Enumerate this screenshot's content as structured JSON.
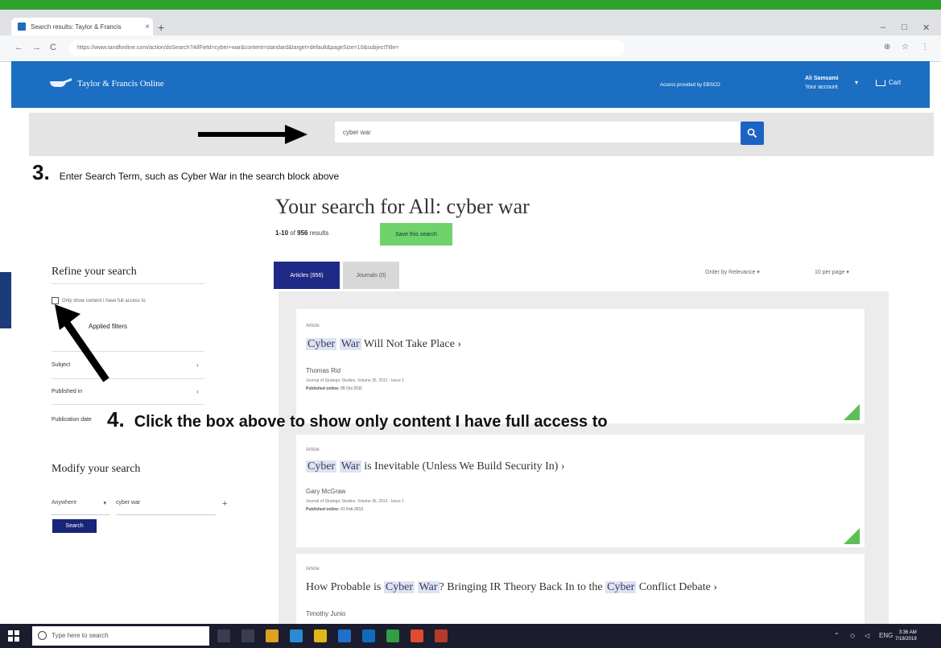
{
  "browser": {
    "strip_note": "",
    "tab_title": "Search results: Taylor & Francis",
    "tab_close": "×",
    "new_tab": "+",
    "url": "https://www.tandfonline.com/action/doSearch?AllField=cyber+war&content=standard&target=default&pageSize=10&subjectTitle=",
    "nav": {
      "back": "←",
      "forward": "→",
      "reload": "C"
    },
    "window_controls": [
      "–",
      "□",
      "✕"
    ]
  },
  "header": {
    "logo_text": "Taylor & Francis Online",
    "access_text": "Access provided by EBSCO",
    "account_name": "Ali Samsami",
    "account_sub": "Your account",
    "cart_label": "Cart"
  },
  "search": {
    "value": "cyber war"
  },
  "annotations": {
    "step3_num": "3.",
    "step3_text": "Enter Search Term, such as Cyber War in the search block above",
    "step4_num": "4.",
    "step4_text": "Click the box above to show only content I have full access to"
  },
  "results": {
    "title": "Your search for All: cyber war",
    "count_range": "1-10",
    "count_total": "956",
    "count_suffix": "results",
    "save_label": "Save this search",
    "tabs": [
      {
        "label": "Articles (956)"
      },
      {
        "label": "Journals (0)"
      }
    ],
    "sort_label": "Order by Relevance",
    "per_page_label": "10 per page",
    "items": [
      {
        "type": "Article",
        "title_prefix": "",
        "title_hl1": "Cyber",
        "title_hl2": "War",
        "title_rest": " Will Not Take Place",
        "author": "Thomas Rid",
        "journal": "Journal of Strategic Studies, Volume 35, 2012 - Issue 1",
        "published_label": "Published online:",
        "published_date": "05 Oct 2011"
      },
      {
        "type": "Article",
        "title_prefix": "",
        "title_hl1": "Cyber",
        "title_hl2": "War",
        "title_rest": " is Inevitable (Unless We Build Security In)",
        "author": "Gary McGraw",
        "journal": "Journal of Strategic Studies, Volume 36, 2013 - Issue 1",
        "published_label": "Published online:",
        "published_date": "01 Feb 2013"
      },
      {
        "type": "Article",
        "title_prefix": "How Probable is ",
        "title_hl1": "Cyber",
        "title_hl2": "War",
        "title_rest": "? Bringing IR Theory Back In to the ",
        "title_hl3": "Cyber",
        "title_tail": " Conflict Debate",
        "author": "Timothy Junio"
      }
    ],
    "chevron": "›"
  },
  "sidebar": {
    "refine_heading": "Refine your search",
    "fullaccess_label": "Only show content I have full access to",
    "applied_filters": "Applied filters",
    "facets": [
      "Subject",
      "Published in",
      "Publication date"
    ],
    "facet_chevron": "›",
    "modify_heading": "Modify your search",
    "modify_field": "Anywhere",
    "modify_value": "cyber war",
    "modify_plus": "+",
    "modify_button": "Search"
  },
  "taskbar": {
    "search_placeholder": "Type here to search",
    "time": "3:36 AM",
    "date": "7/18/2019"
  }
}
